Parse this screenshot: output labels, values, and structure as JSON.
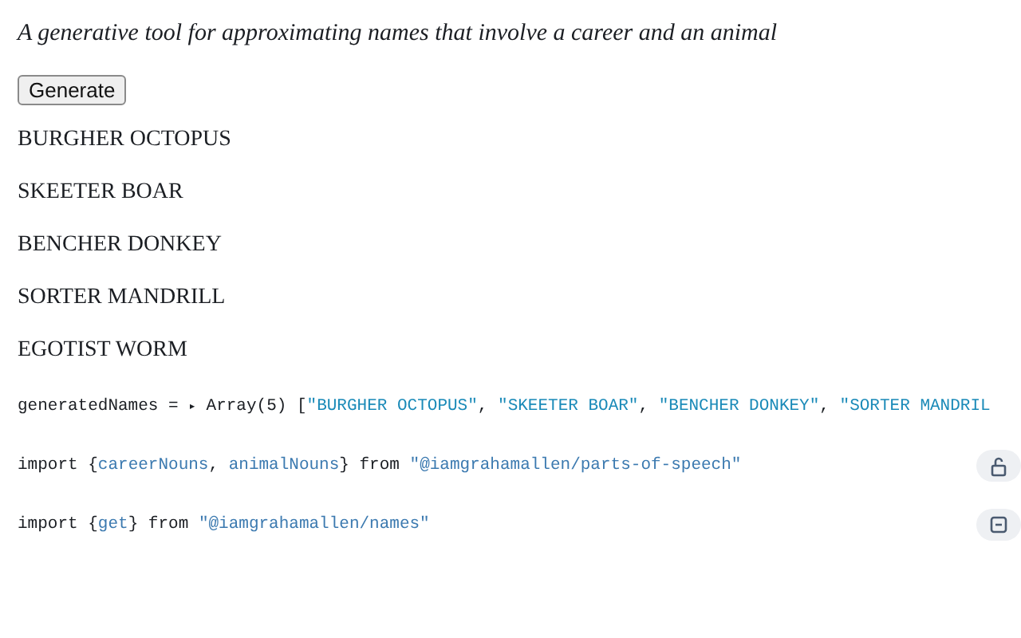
{
  "description": "A generative tool for approximating names that involve a career and an animal",
  "button": "Generate",
  "names": [
    "BURGHER OCTOPUS",
    "SKEETER BOAR",
    "BENCHER DONKEY",
    "SORTER MANDRILL",
    "EGOTIST WORM"
  ],
  "cells": [
    {
      "kind": "value",
      "tokens": [
        {
          "kind": "plain",
          "text": "generatedNames = "
        },
        {
          "kind": "toggle",
          "text": "▸"
        },
        {
          "kind": "plain",
          "text": "Array(5) ["
        },
        {
          "kind": "string",
          "text": "\"BURGHER OCTOPUS\""
        },
        {
          "kind": "plain",
          "text": ", "
        },
        {
          "kind": "string",
          "text": "\"SKEETER BOAR\""
        },
        {
          "kind": "plain",
          "text": ", "
        },
        {
          "kind": "string",
          "text": "\"BENCHER DONKEY\""
        },
        {
          "kind": "plain",
          "text": ", "
        },
        {
          "kind": "string",
          "text": "\"SORTER MANDRIL"
        }
      ]
    },
    {
      "kind": "unlockable",
      "tokens": [
        {
          "kind": "plain",
          "text": "import {"
        },
        {
          "kind": "name",
          "text": "careerNouns"
        },
        {
          "kind": "plain",
          "text": ", "
        },
        {
          "kind": "name",
          "text": "animalNouns"
        },
        {
          "kind": "plain",
          "text": "} from "
        },
        {
          "kind": "module",
          "text": "\"@iamgrahamallen/parts-of-speech\""
        }
      ]
    },
    {
      "kind": "collapsible",
      "tokens": [
        {
          "kind": "plain",
          "text": "import {"
        },
        {
          "kind": "name",
          "text": "get"
        },
        {
          "kind": "plain",
          "text": "} from "
        },
        {
          "kind": "module",
          "text": "\"@iamgrahamallen/names\""
        }
      ]
    }
  ]
}
